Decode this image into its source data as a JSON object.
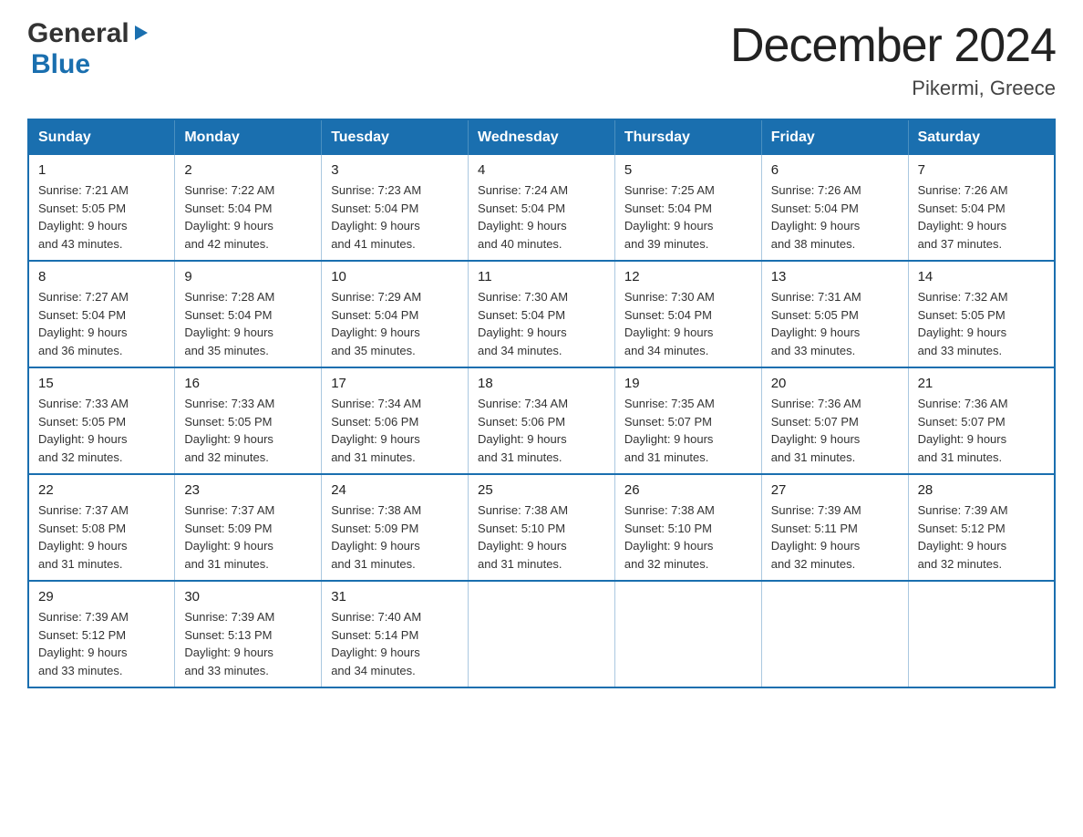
{
  "header": {
    "logo": {
      "general": "General",
      "blue": "Blue",
      "arrow_unicode": "▶"
    },
    "title": "December 2024",
    "location": "Pikermi, Greece"
  },
  "calendar": {
    "days_of_week": [
      "Sunday",
      "Monday",
      "Tuesday",
      "Wednesday",
      "Thursday",
      "Friday",
      "Saturday"
    ],
    "weeks": [
      [
        {
          "day": "1",
          "sunrise": "7:21 AM",
          "sunset": "5:05 PM",
          "daylight": "9 hours and 43 minutes."
        },
        {
          "day": "2",
          "sunrise": "7:22 AM",
          "sunset": "5:04 PM",
          "daylight": "9 hours and 42 minutes."
        },
        {
          "day": "3",
          "sunrise": "7:23 AM",
          "sunset": "5:04 PM",
          "daylight": "9 hours and 41 minutes."
        },
        {
          "day": "4",
          "sunrise": "7:24 AM",
          "sunset": "5:04 PM",
          "daylight": "9 hours and 40 minutes."
        },
        {
          "day": "5",
          "sunrise": "7:25 AM",
          "sunset": "5:04 PM",
          "daylight": "9 hours and 39 minutes."
        },
        {
          "day": "6",
          "sunrise": "7:26 AM",
          "sunset": "5:04 PM",
          "daylight": "9 hours and 38 minutes."
        },
        {
          "day": "7",
          "sunrise": "7:26 AM",
          "sunset": "5:04 PM",
          "daylight": "9 hours and 37 minutes."
        }
      ],
      [
        {
          "day": "8",
          "sunrise": "7:27 AM",
          "sunset": "5:04 PM",
          "daylight": "9 hours and 36 minutes."
        },
        {
          "day": "9",
          "sunrise": "7:28 AM",
          "sunset": "5:04 PM",
          "daylight": "9 hours and 35 minutes."
        },
        {
          "day": "10",
          "sunrise": "7:29 AM",
          "sunset": "5:04 PM",
          "daylight": "9 hours and 35 minutes."
        },
        {
          "day": "11",
          "sunrise": "7:30 AM",
          "sunset": "5:04 PM",
          "daylight": "9 hours and 34 minutes."
        },
        {
          "day": "12",
          "sunrise": "7:30 AM",
          "sunset": "5:04 PM",
          "daylight": "9 hours and 34 minutes."
        },
        {
          "day": "13",
          "sunrise": "7:31 AM",
          "sunset": "5:05 PM",
          "daylight": "9 hours and 33 minutes."
        },
        {
          "day": "14",
          "sunrise": "7:32 AM",
          "sunset": "5:05 PM",
          "daylight": "9 hours and 33 minutes."
        }
      ],
      [
        {
          "day": "15",
          "sunrise": "7:33 AM",
          "sunset": "5:05 PM",
          "daylight": "9 hours and 32 minutes."
        },
        {
          "day": "16",
          "sunrise": "7:33 AM",
          "sunset": "5:05 PM",
          "daylight": "9 hours and 32 minutes."
        },
        {
          "day": "17",
          "sunrise": "7:34 AM",
          "sunset": "5:06 PM",
          "daylight": "9 hours and 31 minutes."
        },
        {
          "day": "18",
          "sunrise": "7:34 AM",
          "sunset": "5:06 PM",
          "daylight": "9 hours and 31 minutes."
        },
        {
          "day": "19",
          "sunrise": "7:35 AM",
          "sunset": "5:07 PM",
          "daylight": "9 hours and 31 minutes."
        },
        {
          "day": "20",
          "sunrise": "7:36 AM",
          "sunset": "5:07 PM",
          "daylight": "9 hours and 31 minutes."
        },
        {
          "day": "21",
          "sunrise": "7:36 AM",
          "sunset": "5:07 PM",
          "daylight": "9 hours and 31 minutes."
        }
      ],
      [
        {
          "day": "22",
          "sunrise": "7:37 AM",
          "sunset": "5:08 PM",
          "daylight": "9 hours and 31 minutes."
        },
        {
          "day": "23",
          "sunrise": "7:37 AM",
          "sunset": "5:09 PM",
          "daylight": "9 hours and 31 minutes."
        },
        {
          "day": "24",
          "sunrise": "7:38 AM",
          "sunset": "5:09 PM",
          "daylight": "9 hours and 31 minutes."
        },
        {
          "day": "25",
          "sunrise": "7:38 AM",
          "sunset": "5:10 PM",
          "daylight": "9 hours and 31 minutes."
        },
        {
          "day": "26",
          "sunrise": "7:38 AM",
          "sunset": "5:10 PM",
          "daylight": "9 hours and 32 minutes."
        },
        {
          "day": "27",
          "sunrise": "7:39 AM",
          "sunset": "5:11 PM",
          "daylight": "9 hours and 32 minutes."
        },
        {
          "day": "28",
          "sunrise": "7:39 AM",
          "sunset": "5:12 PM",
          "daylight": "9 hours and 32 minutes."
        }
      ],
      [
        {
          "day": "29",
          "sunrise": "7:39 AM",
          "sunset": "5:12 PM",
          "daylight": "9 hours and 33 minutes."
        },
        {
          "day": "30",
          "sunrise": "7:39 AM",
          "sunset": "5:13 PM",
          "daylight": "9 hours and 33 minutes."
        },
        {
          "day": "31",
          "sunrise": "7:40 AM",
          "sunset": "5:14 PM",
          "daylight": "9 hours and 34 minutes."
        },
        null,
        null,
        null,
        null
      ]
    ],
    "labels": {
      "sunrise": "Sunrise:",
      "sunset": "Sunset:",
      "daylight": "Daylight:"
    }
  }
}
